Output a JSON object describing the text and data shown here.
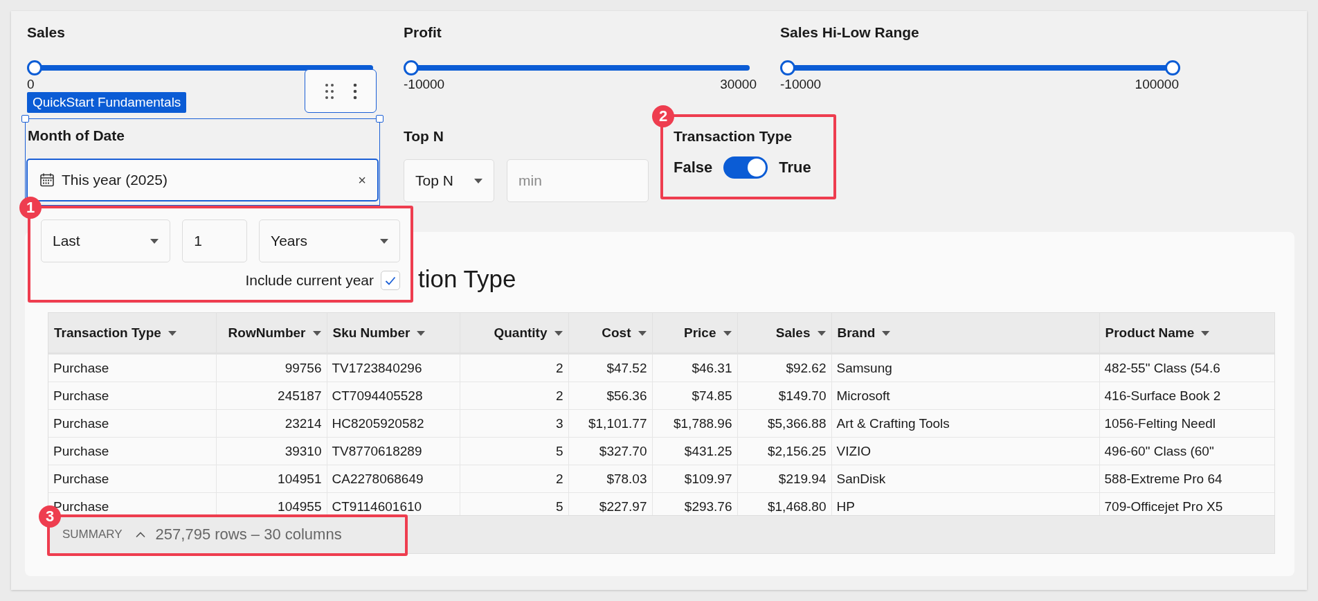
{
  "sliders": [
    {
      "label": "Sales",
      "kind": "single",
      "level": 1,
      "min_label": "0"
    },
    {
      "label": "Profit",
      "kind": "single",
      "level": 1,
      "min_label": "-10000",
      "max_label": "30000"
    },
    {
      "label": "Sales Hi-Low Range",
      "kind": "range",
      "level": 1,
      "min_label": "-10000",
      "max_label": "100000"
    }
  ],
  "date_control": {
    "label": "Month of Date",
    "value": "This year (2025)",
    "clear": "×",
    "selected": true,
    "tag": "QuickStart Fundamentals"
  },
  "top_n": {
    "label": "Top N",
    "dropdown": "Top N",
    "placeholder": "min"
  },
  "toggle": {
    "label": "Transaction Type",
    "off_label": "False",
    "on_label": "True",
    "on": true
  },
  "popover": {
    "operator": "Last",
    "amount": "1",
    "unit": "Years",
    "checkbox_label": "Include current year",
    "checked": true
  },
  "card": {
    "title": "tion Type",
    "table": {
      "columns": [
        {
          "label": "Transaction Type"
        },
        {
          "label": "RowNumber"
        },
        {
          "label": "Sku Number"
        },
        {
          "label": "Quantity"
        },
        {
          "label": "Cost"
        },
        {
          "label": "Price"
        },
        {
          "label": "Sales"
        },
        {
          "label": "Brand"
        },
        {
          "label": "Product Name"
        }
      ],
      "rows": [
        [
          "Purchase",
          "99756",
          "TV1723840296",
          "2",
          "$47.52",
          "$46.31",
          "$92.62",
          "Samsung",
          "482-55\" Class (54.6"
        ],
        [
          "Purchase",
          "245187",
          "CT7094405528",
          "2",
          "$56.36",
          "$74.85",
          "$149.70",
          "Microsoft",
          "416-Surface Book 2"
        ],
        [
          "Purchase",
          "23214",
          "HC8205920582",
          "3",
          "$1,101.77",
          "$1,788.96",
          "$5,366.88",
          "Art & Crafting Tools",
          "1056-Felting Needl"
        ],
        [
          "Purchase",
          "39310",
          "TV8770618289",
          "5",
          "$327.70",
          "$431.25",
          "$2,156.25",
          "VIZIO",
          "496-60\" Class (60\""
        ],
        [
          "Purchase",
          "104951",
          "CA2278068649",
          "2",
          "$78.03",
          "$109.97",
          "$219.94",
          "SanDisk",
          "588-Extreme Pro 64"
        ],
        [
          "Purchase",
          "104955",
          "CT9114601610",
          "5",
          "$227.97",
          "$293.76",
          "$1,468.80",
          "HP",
          "709-Officejet Pro X5"
        ]
      ]
    },
    "summary": {
      "label": "SUMMARY",
      "counts": "257,795 rows – 30 columns"
    }
  },
  "annotations": [
    {
      "number": "1"
    },
    {
      "number": "2"
    },
    {
      "number": "3"
    }
  ]
}
